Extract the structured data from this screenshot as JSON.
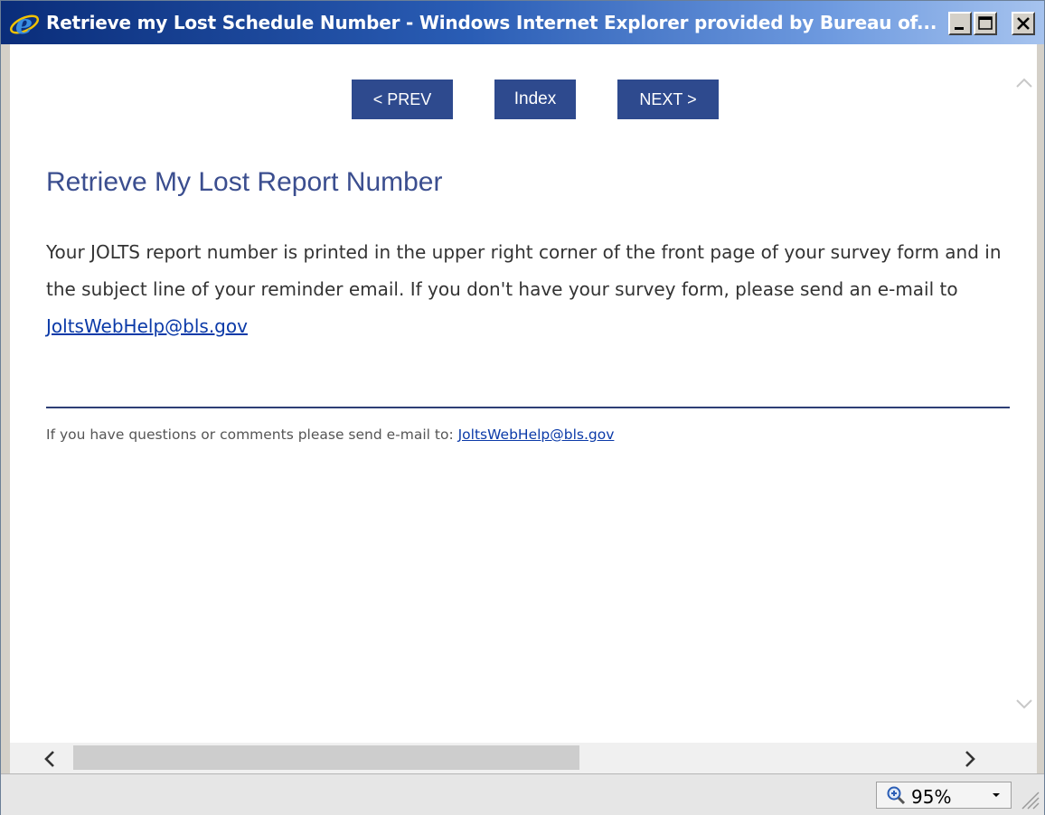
{
  "window": {
    "title": "Retrieve my Lost Schedule Number - Windows Internet Explorer provided by Bureau of..."
  },
  "nav": {
    "prev_label": "< PREV",
    "index_label": "Index",
    "next_label": "NEXT >"
  },
  "page": {
    "heading": "Retrieve My Lost Report Number",
    "body_text": "Your JOLTS report number is printed in the upper right corner of the front page of your survey form and in the subject line of your reminder email. If you don't have your survey form, please send an e-mail to ",
    "body_link": "JoltsWebHelp@bls.gov",
    "footer_text": "If you have questions or comments please send e-mail to: ",
    "footer_link": "JoltsWebHelp@bls.gov"
  },
  "statusbar": {
    "zoom": "95%"
  },
  "colors": {
    "button_bg": "#2e4a8e",
    "heading": "#3b4e8f",
    "link": "#0b3aa8"
  }
}
